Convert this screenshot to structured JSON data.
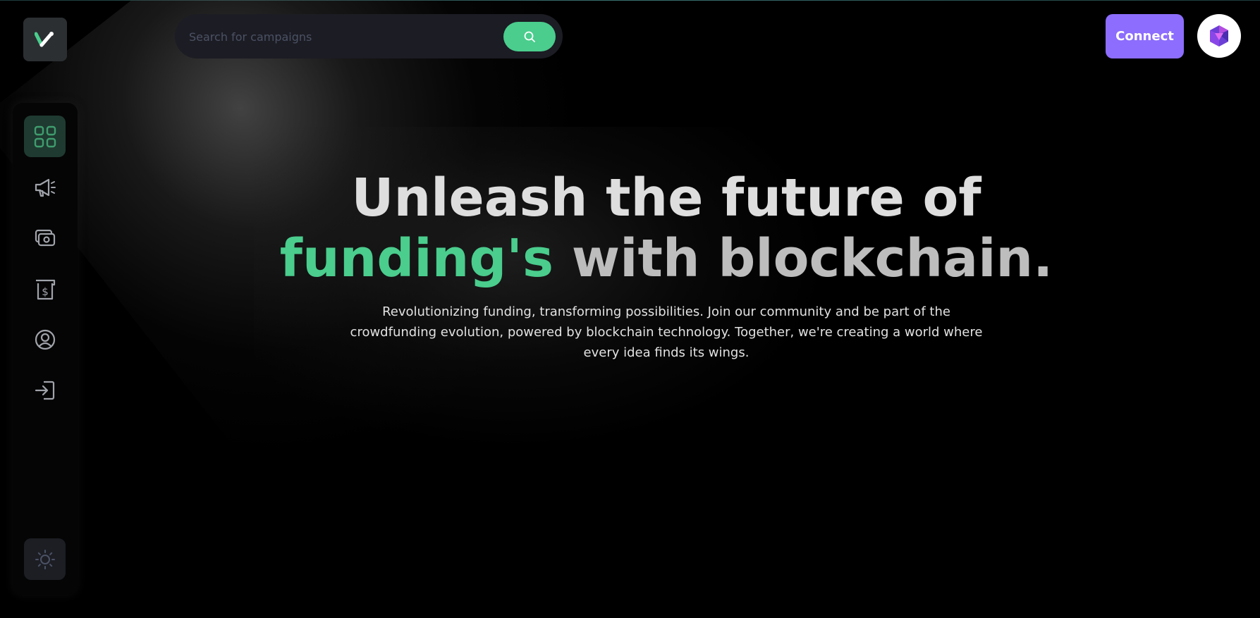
{
  "header": {
    "search": {
      "placeholder": "Search for campaigns",
      "value": ""
    },
    "connect_label": "Connect"
  },
  "sidebar": {
    "items": [
      {
        "name": "dashboard",
        "icon": "grid-icon",
        "active": true
      },
      {
        "name": "campaigns",
        "icon": "megaphone-icon",
        "active": false
      },
      {
        "name": "payments",
        "icon": "money-icon",
        "active": false
      },
      {
        "name": "withdraw",
        "icon": "dollar-receipt-icon",
        "active": false
      },
      {
        "name": "profile",
        "icon": "user-icon",
        "active": false
      },
      {
        "name": "logout",
        "icon": "logout-icon",
        "active": false
      }
    ],
    "theme_icon": "sun-icon"
  },
  "hero": {
    "line1": "Unleash the future of",
    "accent": "funding's",
    "line2_rest": "with blockchain.",
    "description": "Revolutionizing funding, transforming possibilities. Join our community and be part of the crowdfunding evolution, powered by blockchain technology. Together, we're creating a world where every idea finds its wings."
  },
  "colors": {
    "accent": "#4acd8d",
    "connect": "#8c6dfd",
    "background": "#000000",
    "surface": "#1c1c24"
  }
}
